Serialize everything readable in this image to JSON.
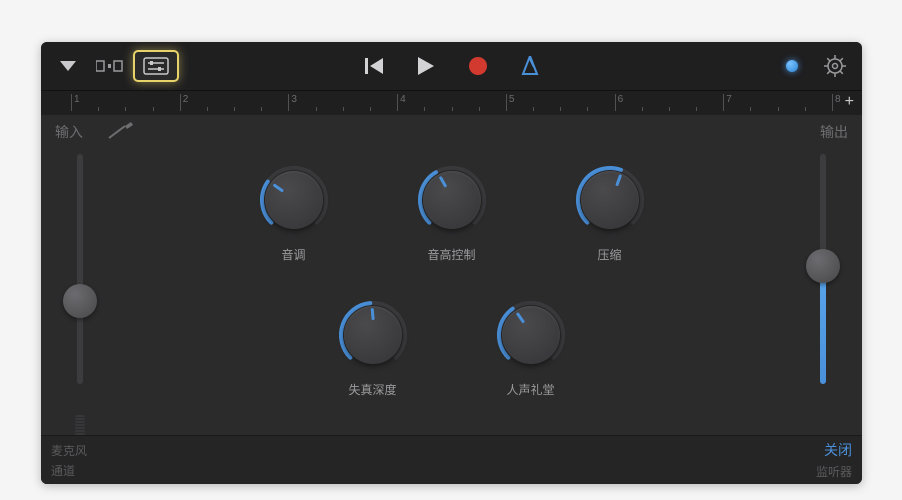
{
  "io": {
    "input_label": "输入",
    "output_label": "输出"
  },
  "ruler": {
    "ticks": [
      "1",
      "2",
      "3",
      "4",
      "5",
      "6",
      "7",
      "8"
    ]
  },
  "knobs": [
    {
      "label": "音调",
      "angle": -55,
      "arc_start": -135,
      "arc_end": -55
    },
    {
      "label": "音高控制",
      "angle": -30,
      "arc_start": -135,
      "arc_end": -30
    },
    {
      "label": "压缩",
      "angle": 20,
      "arc_start": -135,
      "arc_end": 20
    },
    {
      "label": "失真深度",
      "angle": -5,
      "arc_start": -135,
      "arc_end": -5
    },
    {
      "label": "人声礼堂",
      "angle": -35,
      "arc_start": -135,
      "arc_end": -35
    }
  ],
  "footer": {
    "source": "麦克风",
    "channel": "通道",
    "close": "关闭",
    "monitor": "监听器"
  },
  "colors": {
    "accent": "#4a90d9"
  }
}
